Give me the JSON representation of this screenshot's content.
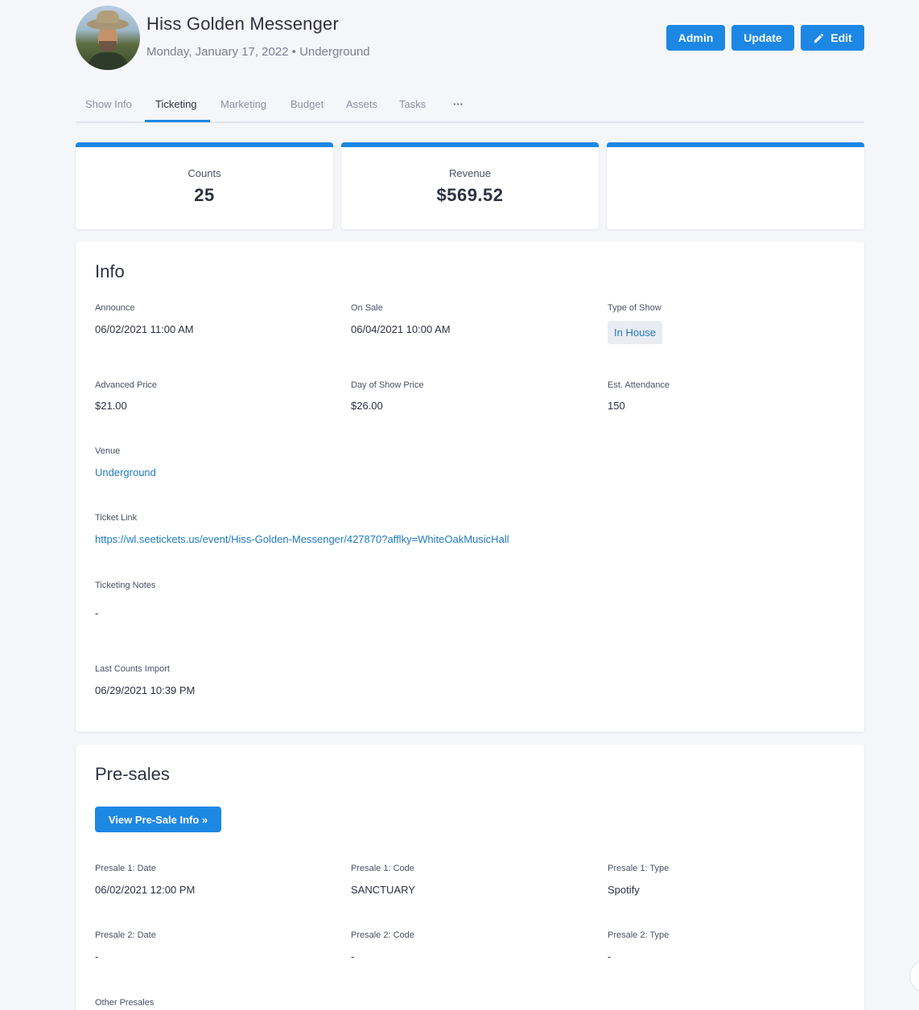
{
  "header": {
    "title": "Hiss Golden Messenger",
    "subtitle": "Monday, January 17, 2022 • Underground",
    "buttons": {
      "admin": "Admin",
      "update": "Update",
      "edit": "Edit"
    },
    "edit_icon": "pencil-icon"
  },
  "tabs": [
    {
      "label": "Show Info",
      "active": false
    },
    {
      "label": "Ticketing",
      "active": true
    },
    {
      "label": "Marketing",
      "active": false
    },
    {
      "label": "Budget",
      "active": false
    },
    {
      "label": "Assets",
      "active": false
    },
    {
      "label": "Tasks",
      "active": false
    },
    {
      "label": "···",
      "active": false
    }
  ],
  "stats": {
    "counts": {
      "label": "Counts",
      "value": "25"
    },
    "revenue": {
      "label": "Revenue",
      "value": "$569.52"
    }
  },
  "info": {
    "title": "Info",
    "announce": {
      "label": "Announce",
      "value": "06/02/2021 11:00 AM"
    },
    "on_sale": {
      "label": "On Sale",
      "value": "06/04/2021 10:00 AM"
    },
    "type_of_show": {
      "label": "Type of Show",
      "value": "In House"
    },
    "advanced_price": {
      "label": "Advanced Price",
      "value": "$21.00"
    },
    "day_of_show_price": {
      "label": "Day of Show Price",
      "value": "$26.00"
    },
    "est_attendance": {
      "label": "Est. Attendance",
      "value": "150"
    },
    "venue": {
      "label": "Venue",
      "value": "Underground"
    },
    "ticket_link": {
      "label": "Ticket Link",
      "value": "https://wl.seetickets.us/event/Hiss-Golden-Messenger/427870?afflky=WhiteOakMusicHall"
    },
    "ticketing_notes": {
      "label": "Ticketing Notes",
      "value": "-"
    },
    "last_counts_import": {
      "label": "Last Counts Import",
      "value": "06/29/2021 10:39 PM"
    }
  },
  "presales": {
    "title": "Pre-sales",
    "button": "View Pre-Sale Info »",
    "p1_date": {
      "label": "Presale 1: Date",
      "value": "06/02/2021 12:00 PM"
    },
    "p1_code": {
      "label": "Presale 1: Code",
      "value": "SANCTUARY"
    },
    "p1_type": {
      "label": "Presale 1: Type",
      "value": "Spotify"
    },
    "p2_date": {
      "label": "Presale 2: Date",
      "value": "-"
    },
    "p2_code": {
      "label": "Presale 2: Code",
      "value": "-"
    },
    "p2_type": {
      "label": "Presale 2: Type",
      "value": "-"
    },
    "other": {
      "label": "Other Presales"
    }
  },
  "colors": {
    "accent": "#1d87e4",
    "link": "#1f7ac4",
    "background": "#f5f6fa"
  }
}
